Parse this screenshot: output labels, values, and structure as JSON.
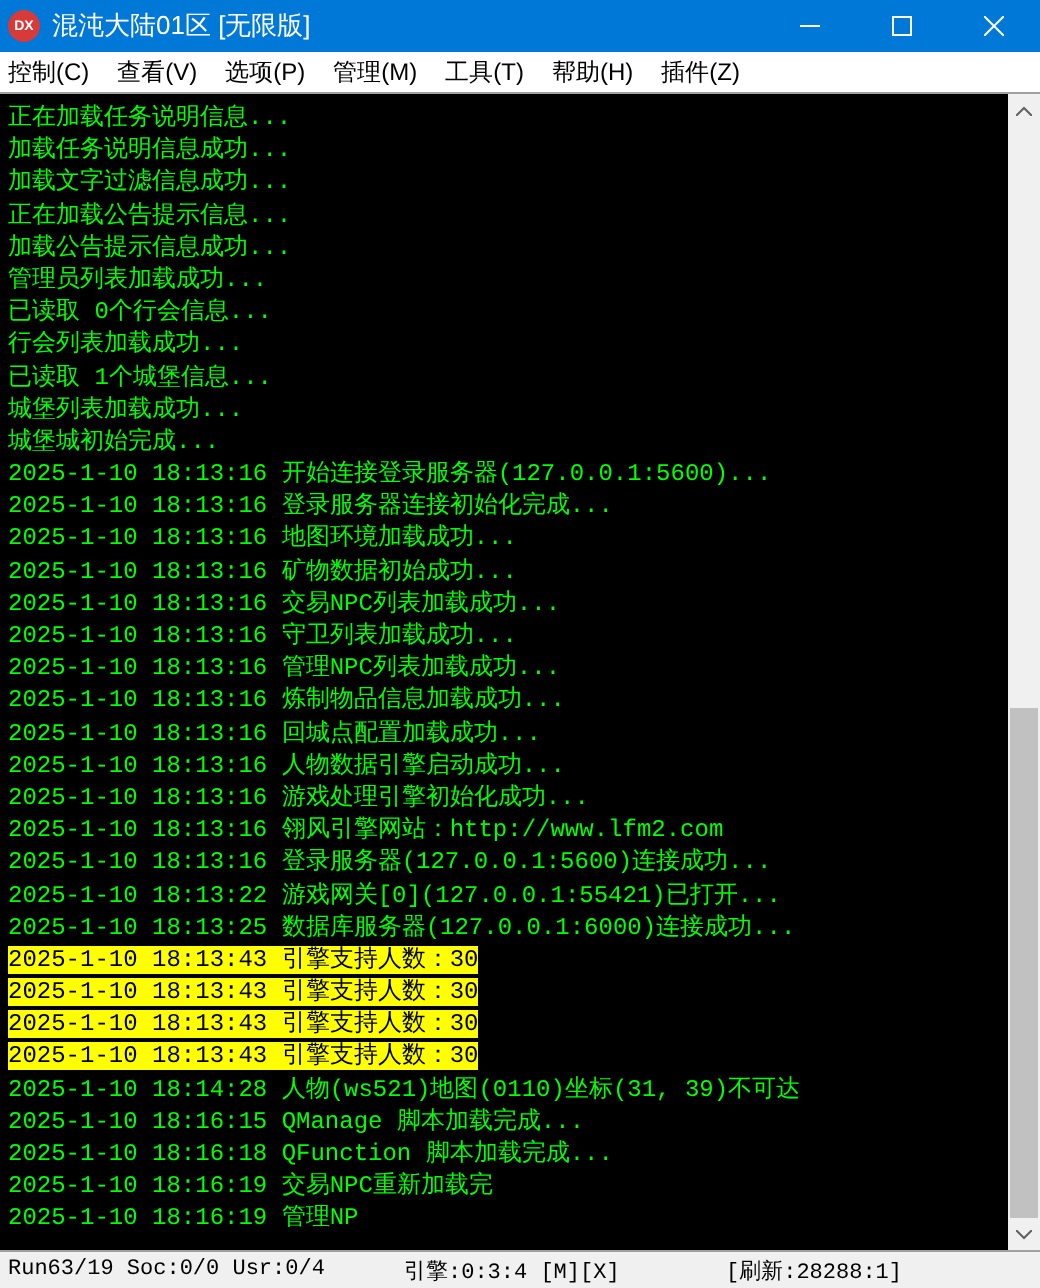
{
  "window": {
    "title": "混沌大陆01区 [无限版]",
    "icon_label": "DX"
  },
  "menu": [
    {
      "label": "控制(C)"
    },
    {
      "label": "查看(V)"
    },
    {
      "label": "选项(P)"
    },
    {
      "label": "管理(M)"
    },
    {
      "label": "工具(T)"
    },
    {
      "label": "帮助(H)"
    },
    {
      "label": "插件(Z)"
    }
  ],
  "log": [
    {
      "text": "正在加载任务说明信息...",
      "highlighted": false
    },
    {
      "text": "加载任务说明信息成功...",
      "highlighted": false
    },
    {
      "text": "加载文字过滤信息成功...",
      "highlighted": false
    },
    {
      "text": "正在加载公告提示信息...",
      "highlighted": false
    },
    {
      "text": "加载公告提示信息成功...",
      "highlighted": false
    },
    {
      "text": "管理员列表加载成功...",
      "highlighted": false
    },
    {
      "text": "已读取 0个行会信息...",
      "highlighted": false
    },
    {
      "text": "行会列表加载成功...",
      "highlighted": false
    },
    {
      "text": "已读取 1个城堡信息...",
      "highlighted": false
    },
    {
      "text": "城堡列表加载成功...",
      "highlighted": false
    },
    {
      "text": "城堡城初始完成...",
      "highlighted": false
    },
    {
      "text": "2025-1-10 18:13:16 开始连接登录服务器(127.0.0.1:5600)...",
      "highlighted": false
    },
    {
      "text": "2025-1-10 18:13:16 登录服务器连接初始化完成...",
      "highlighted": false
    },
    {
      "text": "2025-1-10 18:13:16 地图环境加载成功...",
      "highlighted": false
    },
    {
      "text": "2025-1-10 18:13:16 矿物数据初始成功...",
      "highlighted": false
    },
    {
      "text": "2025-1-10 18:13:16 交易NPC列表加载成功...",
      "highlighted": false
    },
    {
      "text": "2025-1-10 18:13:16 守卫列表加载成功...",
      "highlighted": false
    },
    {
      "text": "2025-1-10 18:13:16 管理NPC列表加载成功...",
      "highlighted": false
    },
    {
      "text": "2025-1-10 18:13:16 炼制物品信息加载成功...",
      "highlighted": false
    },
    {
      "text": "2025-1-10 18:13:16 回城点配置加载成功...",
      "highlighted": false
    },
    {
      "text": "2025-1-10 18:13:16 人物数据引擎启动成功...",
      "highlighted": false
    },
    {
      "text": "2025-1-10 18:13:16 游戏处理引擎初始化成功...",
      "highlighted": false
    },
    {
      "text": "2025-1-10 18:13:16 翎风引擎网站：http://www.lfm2.com",
      "highlighted": false
    },
    {
      "text": "2025-1-10 18:13:16 登录服务器(127.0.0.1:5600)连接成功...",
      "highlighted": false
    },
    {
      "text": "2025-1-10 18:13:22 游戏网关[0](127.0.0.1:55421)已打开...",
      "highlighted": false
    },
    {
      "text": "2025-1-10 18:13:25 数据库服务器(127.0.0.1:6000)连接成功...",
      "highlighted": false
    },
    {
      "text": "2025-1-10 18:13:43 引擎支持人数：30",
      "highlighted": true
    },
    {
      "text": "2025-1-10 18:13:43 引擎支持人数：30",
      "highlighted": true
    },
    {
      "text": "2025-1-10 18:13:43 引擎支持人数：30",
      "highlighted": true
    },
    {
      "text": "2025-1-10 18:13:43 引擎支持人数：30",
      "highlighted": true
    },
    {
      "text": "2025-1-10 18:14:28 人物(ws521)地图(0110)坐标(31, 39)不可达",
      "highlighted": false
    },
    {
      "text": "2025-1-10 18:16:15 QManage 脚本加载完成...",
      "highlighted": false
    },
    {
      "text": "2025-1-10 18:16:18 QFunction 脚本加载完成...",
      "highlighted": false
    },
    {
      "text": "2025-1-10 18:16:19 交易NPC重新加载完",
      "highlighted": false
    },
    {
      "text": "2025-1-10 18:16:19 管理NP",
      "highlighted": false
    }
  ],
  "status_bar": [
    {
      "text": "Run63/19 Soc:0/0 Usr:0/4"
    },
    {
      "text": "引擎:0:3:4 [M][X]"
    },
    {
      "text": "[刷新:28288:1]"
    }
  ]
}
